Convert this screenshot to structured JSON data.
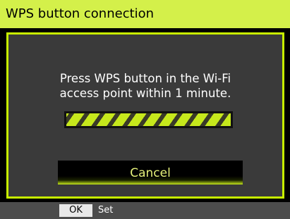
{
  "header": {
    "title": "WPS button connection"
  },
  "dialog": {
    "message_line1": "Press WPS button in the Wi-Fi",
    "message_line2": "access point within 1 minute.",
    "progress_state": "indeterminate",
    "cancel_label": "Cancel"
  },
  "footer": {
    "key_label": "OK",
    "action_label": "Set"
  },
  "colors": {
    "accent": "#d4f04a",
    "dialog_border": "#c8f000",
    "dialog_background": "#3a3a3a",
    "footer_background": "#4c4c4c"
  }
}
